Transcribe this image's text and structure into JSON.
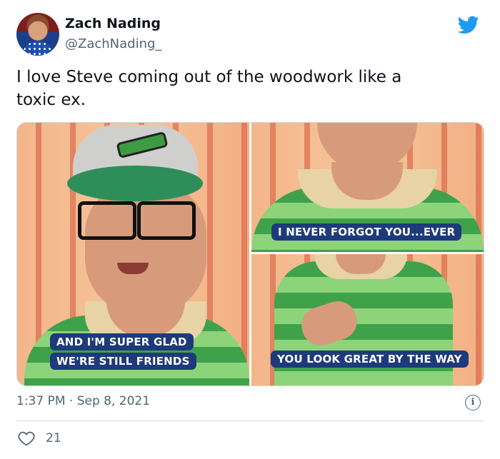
{
  "author": {
    "name": "Zach Nading",
    "handle": "@ZachNading_"
  },
  "tweet": {
    "text": "I love Steve coming out of the woodwork like a\ntoxic ex."
  },
  "media": {
    "captions": {
      "left_line1": "AND I'M SUPER GLAD",
      "left_line2": "WE'RE STILL FRIENDS",
      "top_right": "I NEVER FORGOT YOU...EVER",
      "bottom_right": "YOU LOOK GREAT BY THE WAY"
    }
  },
  "meta": {
    "timestamp": "1:37 PM · Sep 8, 2021",
    "info_label": "i"
  },
  "engagement": {
    "likes": "21"
  },
  "icons": {
    "brand": "twitter-bird-icon",
    "info": "info-icon",
    "like": "heart-icon"
  },
  "colors": {
    "brand_blue": "#1d9bf0",
    "caption_bg": "#1d3a7a",
    "secondary_text": "#536471"
  }
}
